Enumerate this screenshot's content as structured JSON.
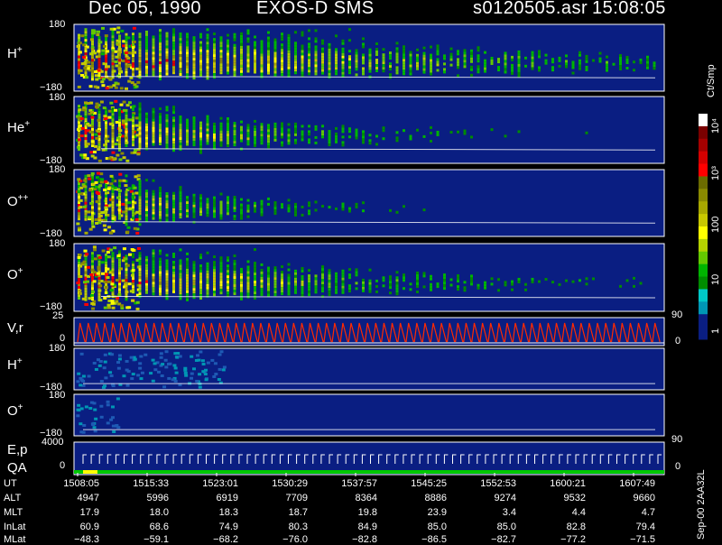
{
  "header": {
    "date": "Dec 05, 1990",
    "instrument": "EXOS-D SMS",
    "file": "s0120505.asr",
    "time": "15:08:05"
  },
  "panels": [
    {
      "label_main": "H",
      "label_sup": "+",
      "tick_top": "180",
      "tick_bottom": "−180"
    },
    {
      "label_main": "He",
      "label_sup": "+",
      "tick_top": "180",
      "tick_bottom": "−180"
    },
    {
      "label_main": "O",
      "label_sup": "++",
      "tick_top": "180",
      "tick_bottom": "−180"
    },
    {
      "label_main": "O",
      "label_sup": "+",
      "tick_top": "180",
      "tick_bottom": "−180"
    },
    {
      "label_main": "V,r",
      "label_sup": "",
      "tick_top": "25",
      "tick_mid": "0",
      "right_top": "90",
      "right_bottom": "0"
    },
    {
      "label_main": "H",
      "label_sup": "+",
      "tick_top": "180",
      "tick_bottom": "−180"
    },
    {
      "label_main": "O",
      "label_sup": "+",
      "tick_top": "180",
      "tick_bottom": "−180"
    },
    {
      "label_main": "E,p",
      "label2": "QA",
      "tick_top": "4000",
      "tick_mid": "0",
      "right_top": "90",
      "right_bottom": "0"
    }
  ],
  "colorbar": {
    "title": "Ct/Smp",
    "ticks": [
      "10⁴",
      "10³",
      "100",
      "10",
      "1"
    ],
    "colors": [
      "#ffffff",
      "#7a0000",
      "#a50000",
      "#d40000",
      "#ff0000",
      "#6b6b00",
      "#8a8a00",
      "#a8a800",
      "#c8c800",
      "#ffff00",
      "#b4d200",
      "#64c800",
      "#00b400",
      "#008c00",
      "#00c8c8",
      "#0096b4",
      "#0a1e82",
      "#0a1e82"
    ]
  },
  "table": {
    "rows": [
      {
        "label": "UT",
        "values": [
          "1508:05",
          "1515:33",
          "1523:01",
          "1530:29",
          "1537:57",
          "1545:25",
          "1552:53",
          "1600:21",
          "1607:49"
        ]
      },
      {
        "label": "ALT",
        "values": [
          "4947",
          "5996",
          "6919",
          "7709",
          "8364",
          "8886",
          "9274",
          "9532",
          "9660"
        ]
      },
      {
        "label": "MLT",
        "values": [
          "17.9",
          "18.0",
          "18.3",
          "18.7",
          "19.8",
          "23.9",
          "3.4",
          "4.4",
          "4.7"
        ]
      },
      {
        "label": "InLat",
        "values": [
          "60.9",
          "68.6",
          "74.9",
          "80.3",
          "84.9",
          "85.0",
          "85.0",
          "82.8",
          "79.4"
        ]
      },
      {
        "label": "MLat",
        "values": [
          "−48.3",
          "−59.1",
          "−68.2",
          "−76.0",
          "−82.8",
          "−86.5",
          "−82.7",
          "−77.2",
          "−71.5"
        ]
      }
    ]
  },
  "footer_vertical": "Sep-00  2AA32L",
  "colors": {
    "background": "#000000",
    "panel_fill": "#0a1e82",
    "vr_trace": "#ff2a00",
    "qa_good": "#00c800",
    "qa_flag": "#ffff00"
  },
  "chart_data": {
    "type": "heatmap",
    "x_axis": "UT",
    "color_scale": "log",
    "color_unit": "Ct/Smp",
    "color_range": [
      1,
      10000
    ],
    "panels": [
      {
        "name": "H+",
        "ylim": [
          -180,
          180
        ]
      },
      {
        "name": "He+",
        "ylim": [
          -180,
          180
        ]
      },
      {
        "name": "O++",
        "ylim": [
          -180,
          180
        ]
      },
      {
        "name": "O+",
        "ylim": [
          -180,
          180
        ]
      },
      {
        "name": "V,r",
        "ylim": [
          0,
          25
        ],
        "right_ylim": [
          0,
          90
        ]
      },
      {
        "name": "H+",
        "ylim": [
          -180,
          180
        ]
      },
      {
        "name": "O+",
        "ylim": [
          -180,
          180
        ]
      },
      {
        "name": "E,p",
        "ylim": [
          0,
          4000
        ],
        "right_ylim": [
          0,
          90
        ]
      }
    ],
    "x_ticks": [
      "1508:05",
      "1515:33",
      "1523:01",
      "1530:29",
      "1537:57",
      "1545:25",
      "1552:53",
      "1600:21",
      "1607:49"
    ]
  }
}
